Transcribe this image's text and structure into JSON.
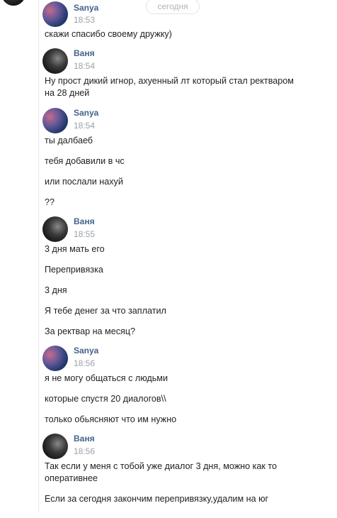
{
  "date_divider": "сегодня",
  "messages": [
    {
      "author": "Sanya",
      "avatar": "sanya",
      "time": "18:53",
      "lines": [
        "скажи спасибо своему дружку)"
      ]
    },
    {
      "author": "Ваня",
      "avatar": "vanya",
      "time": "18:54",
      "lines": [
        "Ну прост дикий игнор, ахуенный лт который стал ректваром",
        "на 28 дней"
      ]
    },
    {
      "author": "Sanya",
      "avatar": "sanya",
      "time": "18:54",
      "lines": [
        "ты далбаеб",
        "тебя добавили в чс",
        "или послали нахуй",
        "??"
      ]
    },
    {
      "author": "Ваня",
      "avatar": "vanya",
      "time": "18:55",
      "lines": [
        "3 дня мать его",
        "Перепривязка",
        "3 дня",
        "Я тебе денег за что заплатил",
        "За ректвар на месяц?"
      ]
    },
    {
      "author": "Sanya",
      "avatar": "sanya",
      "time": "18:56",
      "lines": [
        "я не могу общаться с людьми",
        "которые спустя 20 диалогов\\\\",
        "только обьясняют что им нужно"
      ]
    },
    {
      "author": "Ваня",
      "avatar": "vanya",
      "time": "18:56",
      "lines": [
        "Так если у меня с тобой уже диалог 3 дня, можно как то",
        "оперативнее",
        "Если за сегодня закончим перепривязку,удалим на юг"
      ]
    }
  ]
}
